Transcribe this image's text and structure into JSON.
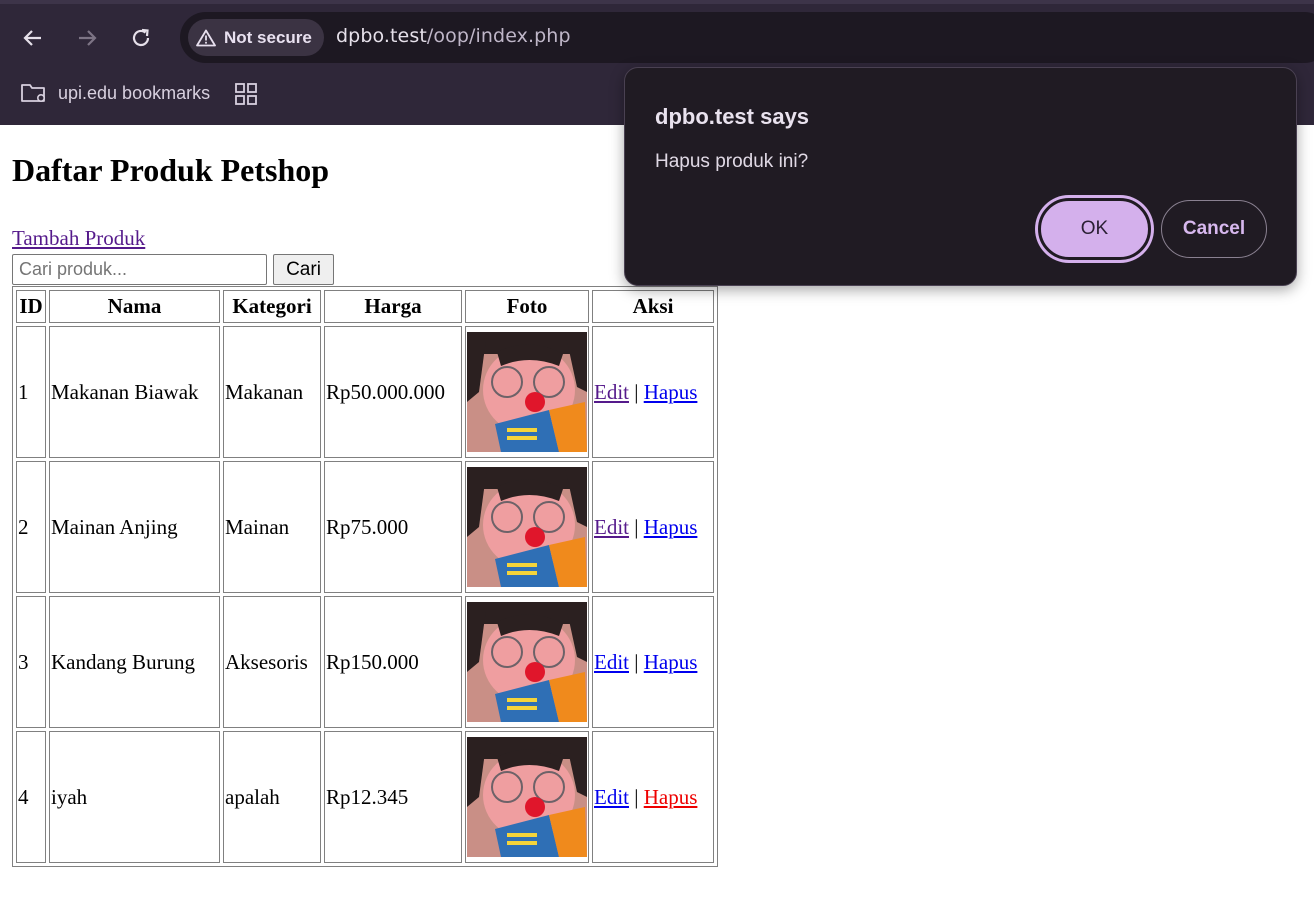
{
  "browser": {
    "security_label": "Not secure",
    "url_host": "dpbo.test",
    "url_path": "/oop/index.php",
    "bookmark_folder": "upi.edu bookmarks",
    "icons": [
      "back-arrow-icon",
      "forward-arrow-icon",
      "reload-icon",
      "warning-icon",
      "folder-settings-icon",
      "apps-grid-icon"
    ]
  },
  "page": {
    "title": "Daftar Produk Petshop",
    "add_link": "Tambah Produk",
    "search": {
      "placeholder": "Cari produk...",
      "value": "",
      "button": "Cari"
    }
  },
  "table": {
    "headers": [
      "ID",
      "Nama",
      "Kategori",
      "Harga",
      "Foto",
      "Aksi"
    ],
    "rows": [
      {
        "id": "1",
        "nama": "Makanan Biawak",
        "kategori": "Makanan",
        "harga": "Rp50.000.000",
        "edit": "Edit",
        "sep": "|",
        "hapus": "Hapus"
      },
      {
        "id": "2",
        "nama": "Mainan Anjing",
        "kategori": "Mainan",
        "harga": "Rp75.000",
        "edit": "Edit",
        "sep": "|",
        "hapus": "Hapus"
      },
      {
        "id": "3",
        "nama": "Kandang Burung",
        "kategori": "Aksesoris",
        "harga": "Rp150.000",
        "edit": "Edit",
        "sep": "|",
        "hapus": "Hapus"
      },
      {
        "id": "4",
        "nama": "iyah",
        "kategori": "apalah",
        "harga": "Rp12.345",
        "edit": "Edit",
        "sep": "|",
        "hapus": "Hapus"
      }
    ]
  },
  "dialog": {
    "title": "dpbo.test says",
    "message": "Hapus produk ini?",
    "ok": "OK",
    "cancel": "Cancel"
  },
  "colors": {
    "chrome_bg": "#2f2739",
    "link_unvisited": "#0000ee",
    "link_visited": "#551a8b",
    "link_active": "#ee0000",
    "dialog_accent": "#d4b0ec"
  }
}
